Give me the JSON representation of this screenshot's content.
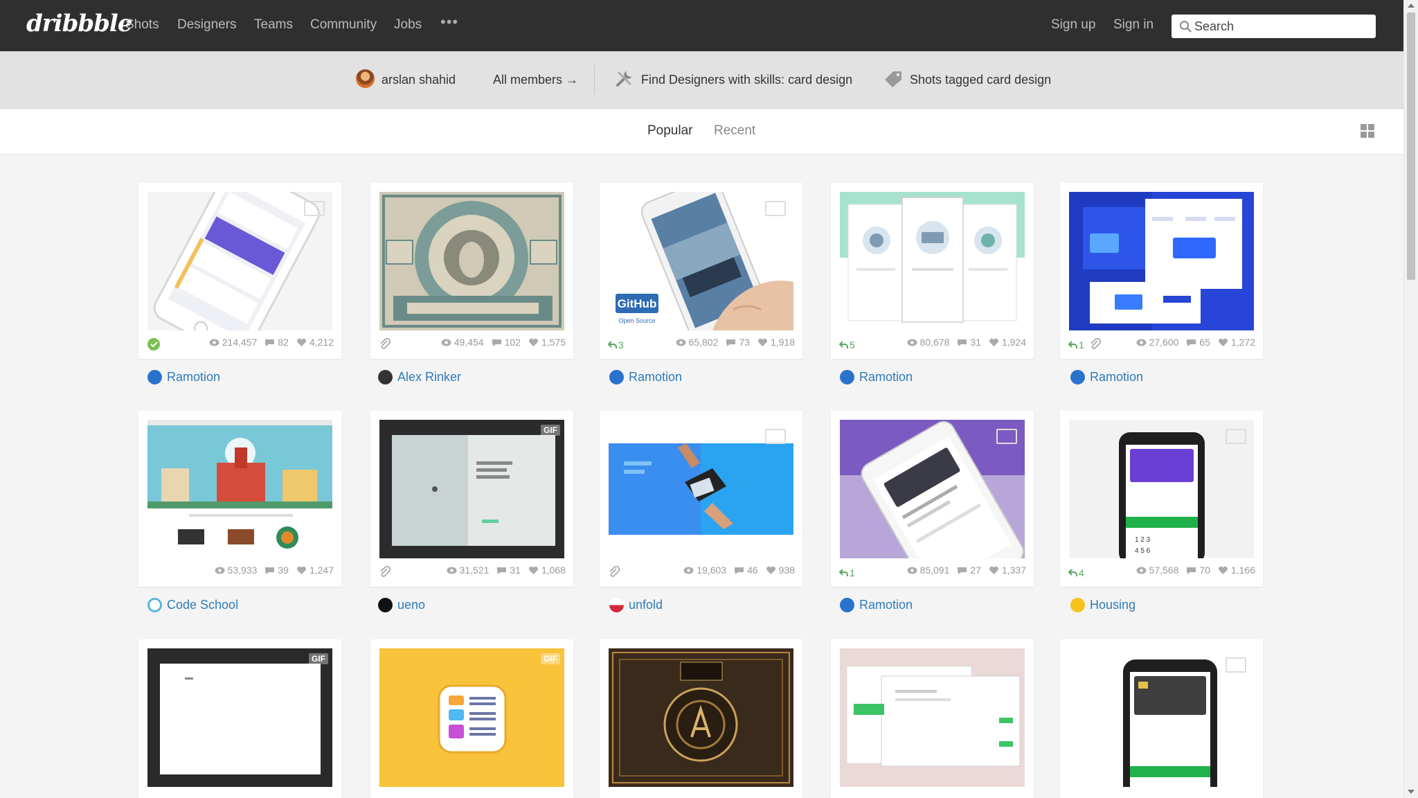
{
  "nav": {
    "logo": "dribbble",
    "links": [
      "Shots",
      "Designers",
      "Teams",
      "Community",
      "Jobs"
    ],
    "more": "•••",
    "sign_up": "Sign up",
    "sign_in": "Sign in",
    "search_placeholder": "Search"
  },
  "filter": {
    "member": "arslan shahid",
    "all_members": "All members →",
    "find_designers": "Find Designers with skills: card design",
    "shots_tagged": "Shots tagged card design"
  },
  "sort": {
    "popular": "Popular",
    "recent": "Recent"
  },
  "colors": {
    "nav_bg": "#2f2f2f",
    "filter_bg": "#e2e2e2",
    "link": "#2e7bb9",
    "rebound": "#58a45e"
  },
  "shots": [
    {
      "author": "Ramotion",
      "views": "214,457",
      "comments": "82",
      "likes": "4,212",
      "rebounds": "",
      "attachment": false,
      "gif": false
    },
    {
      "author": "Alex Rinker",
      "views": "49,454",
      "comments": "102",
      "likes": "1,575",
      "rebounds": "",
      "attachment": true,
      "gif": false
    },
    {
      "author": "Ramotion",
      "views": "65,802",
      "comments": "73",
      "likes": "1,918",
      "rebounds": "3",
      "attachment": false,
      "gif": false
    },
    {
      "author": "Ramotion",
      "views": "80,678",
      "comments": "31",
      "likes": "1,924",
      "rebounds": "5",
      "attachment": false,
      "gif": false
    },
    {
      "author": "Ramotion",
      "views": "27,600",
      "comments": "65",
      "likes": "1,272",
      "rebounds": "1",
      "attachment": true,
      "gif": false
    },
    {
      "author": "Code School",
      "views": "53,933",
      "comments": "39",
      "likes": "1,247",
      "rebounds": "",
      "attachment": false,
      "gif": false
    },
    {
      "author": "ueno",
      "views": "31,521",
      "comments": "31",
      "likes": "1,068",
      "rebounds": "",
      "attachment": true,
      "gif": true
    },
    {
      "author": "unfold",
      "views": "19,603",
      "comments": "46",
      "likes": "938",
      "rebounds": "",
      "attachment": true,
      "gif": false
    },
    {
      "author": "Ramotion",
      "views": "85,091",
      "comments": "27",
      "likes": "1,337",
      "rebounds": "1",
      "attachment": false,
      "gif": false
    },
    {
      "author": "Housing",
      "views": "57,568",
      "comments": "70",
      "likes": "1,166",
      "rebounds": "4",
      "attachment": false,
      "gif": false
    }
  ],
  "thumbnail_text": {
    "github": "GitHub",
    "open_source": "Open Source",
    "gif": "GIF"
  }
}
